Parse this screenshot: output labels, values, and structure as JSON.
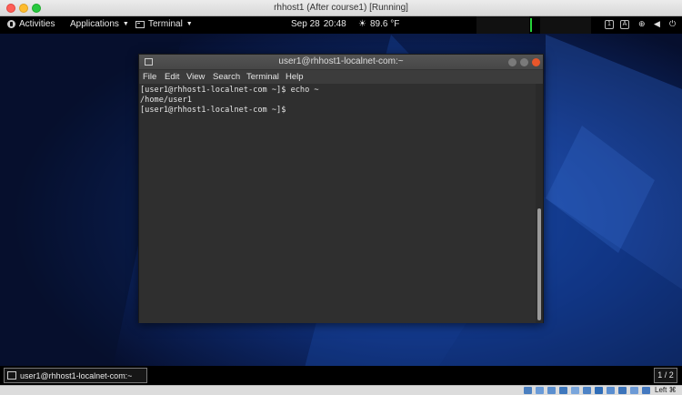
{
  "host": {
    "window_title": "rhhost1 (After course1) [Running]"
  },
  "topbar": {
    "activities": "Activities",
    "applications": "Applications",
    "terminal_app": "Terminal",
    "date": "Sep 28",
    "time": "20:48",
    "weather": "89.6 °F"
  },
  "terminal": {
    "title": "user1@rhhost1-localnet-com:~",
    "menu": [
      "File",
      "Edit",
      "View",
      "Search",
      "Terminal",
      "Help"
    ],
    "lines": [
      "[user1@rhhost1-localnet-com ~]$ echo ~",
      "/home/user1",
      "[user1@rhhost1-localnet-com ~]$"
    ]
  },
  "taskbar": {
    "task_label": "user1@rhhost1-localnet-com:~",
    "workspace": "1 / 2"
  },
  "vbox_status": {
    "host_key": "Left ⌘"
  },
  "colors": {
    "accent_green": "#26d33a",
    "close_orange": "#e8562a",
    "desktop_blue": "#0a1a4a"
  }
}
